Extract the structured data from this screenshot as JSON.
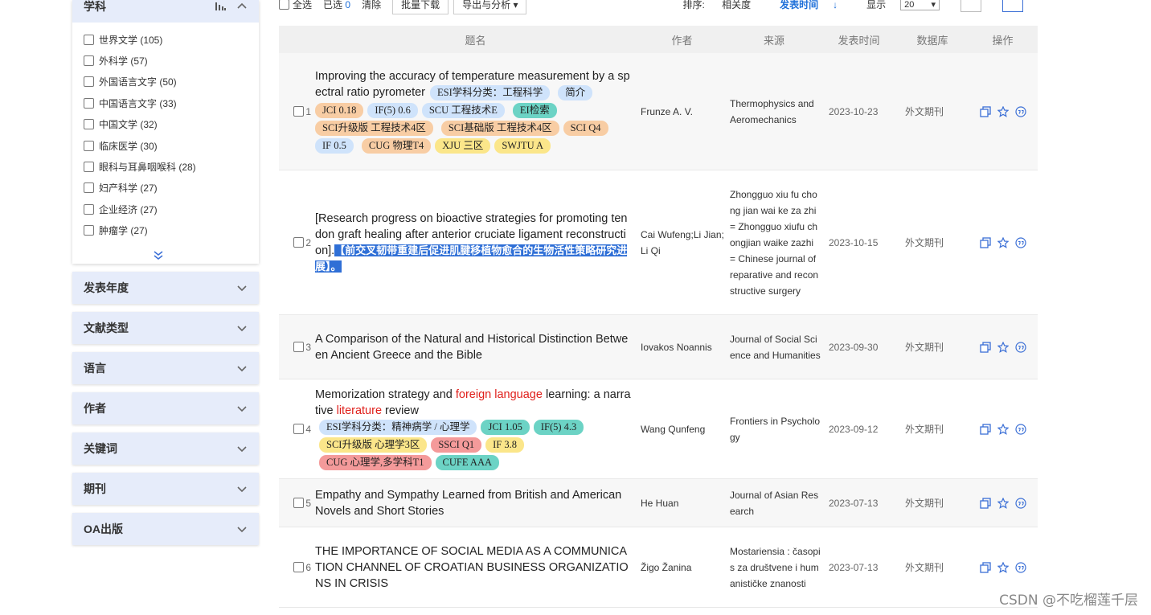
{
  "sidebar": {
    "open_facet": {
      "title": "学科",
      "items": [
        "世界文学 (105)",
        "外科学 (57)",
        "外国语言文字 (50)",
        "中国语言文字 (33)",
        "中国文学 (32)",
        "临床医学 (30)",
        "眼科与耳鼻咽喉科 (28)",
        "妇产科学 (27)",
        "企业经济 (27)",
        "肿瘤学 (27)"
      ]
    },
    "closed_facets": [
      "发表年度",
      "文献类型",
      "语言",
      "作者",
      "关键词",
      "期刊",
      "OA出版"
    ]
  },
  "toolbar": {
    "select_all": "全选",
    "selected_label": "已选",
    "selected_count": "0",
    "clear": "清除",
    "batch_download": "批量下载",
    "export_analysis": "导出与分析",
    "sort_label": "排序:",
    "sort_relevance": "相关度",
    "sort_date": "发表时间",
    "display_label": "显示",
    "page_size": "20"
  },
  "table": {
    "headers": [
      "题名",
      "作者",
      "来源",
      "发表时间",
      "数据库",
      "操作"
    ],
    "rows": [
      {
        "index": "1",
        "title_parts": [
          {
            "text": "Improving the accuracy of temperature measurement by a spectral ratio pyrometer",
            "hl": false
          }
        ],
        "tags": [
          {
            "text": "ESI学科分类：工程科学",
            "color": "blue"
          },
          {
            "text": "简介",
            "color": "blue"
          },
          {
            "text": "JCI 0.18",
            "color": "orange"
          },
          {
            "text": "IF(5) 0.6",
            "color": "blue"
          },
          {
            "text": "SCU 工程技术E",
            "color": "blue"
          },
          {
            "text": "EI检索",
            "color": "teal"
          },
          {
            "text": "SCI升级版 工程技术4区",
            "color": "orange"
          },
          {
            "text": "SCI基础版 工程技术4区",
            "color": "orange"
          },
          {
            "text": "SCI Q4",
            "color": "orange"
          },
          {
            "text": "IF 0.5",
            "color": "blue"
          },
          {
            "text": "CUG 物理T4",
            "color": "orange"
          },
          {
            "text": "XJU 三区",
            "color": "yellow"
          },
          {
            "text": "SWJTU A",
            "color": "yellow"
          }
        ],
        "author": "Frunze A. V.",
        "source": "Thermophysics and Aeromechanics",
        "date": "2023-10-23",
        "db": "外文期刊"
      },
      {
        "index": "2",
        "title_parts": [
          {
            "text": "[Research progress on bioactive strategies for promoting tendon graft healing after anterior cruciate ligament reconstruction].",
            "hl": false
          }
        ],
        "selected_text": "【前交叉韧带重建后促进肌腱移植物愈合的生物活性策略研究进展】。",
        "tags": [],
        "author": "Cai Wufeng;Li Jian;Li Qi",
        "source": "Zhongguo xiu fu chong jian wai ke za zhi = Zhongguo xiufu chongjian waike zazhi = Chinese journal of reparative and reconstructive surgery",
        "date": "2023-10-15",
        "db": "外文期刊"
      },
      {
        "index": "3",
        "title_parts": [
          {
            "text": "A Comparison of the Natural and Historical Distinction Between Ancient Greece and the Bible",
            "hl": false
          }
        ],
        "tags": [],
        "author": "Iovakos Noannis",
        "source": "Journal of Social Science and Humanities",
        "date": "2023-09-30",
        "db": "外文期刊"
      },
      {
        "index": "4",
        "title_parts": [
          {
            "text": "Memorization strategy and ",
            "hl": false
          },
          {
            "text": "foreign language",
            "hl": true
          },
          {
            "text": " learning: a narrative ",
            "hl": false
          },
          {
            "text": "literature",
            "hl": true
          },
          {
            "text": " review",
            "hl": false
          }
        ],
        "tags": [
          {
            "text": "ESI学科分类：精神病学 / 心理学",
            "color": "blue"
          },
          {
            "text": "JCI 1.05",
            "color": "teal"
          },
          {
            "text": "IF(5) 4.3",
            "color": "teal"
          },
          {
            "text": "SCI升级版 心理学3区",
            "color": "yellow"
          },
          {
            "text": "SSCI Q1",
            "color": "red"
          },
          {
            "text": "IF 3.8",
            "color": "yellow"
          },
          {
            "text": "CUG 心理学,多学科T1",
            "color": "red"
          },
          {
            "text": "CUFE AAA",
            "color": "teal"
          }
        ],
        "author": "Wang Qunfeng",
        "source": "Frontiers in Psychology",
        "date": "2023-09-12",
        "db": "外文期刊"
      },
      {
        "index": "5",
        "title_parts": [
          {
            "text": "Empathy and Sympathy Learned from British and American Novels and Short Stories",
            "hl": false
          }
        ],
        "tags": [],
        "author": "He Huan",
        "source": "Journal of Asian Research",
        "date": "2023-07-13",
        "db": "外文期刊"
      },
      {
        "index": "6",
        "title_parts": [
          {
            "text": "THE IMPORTANCE OF SOCIAL MEDIA AS A COMMUNICATION CHANNEL OF CROATIAN BUSINESS ORGANIZATIONS IN CRISIS",
            "hl": false
          }
        ],
        "tags": [],
        "author": "Žigo Žanina",
        "source": "Mostariensia : časopis za društvene i humanističke znanosti",
        "date": "2023-07-13",
        "db": "外文期刊"
      }
    ]
  },
  "colors": {
    "accent": "#2f6fd6",
    "facet_header": "#e6ecfa",
    "highlight_red": "#e0201c",
    "tag_blue": "#cfe3fb",
    "tag_teal": "#6cd3c5",
    "tag_orange": "#f8cda4",
    "tag_yellow": "#fbe68a",
    "tag_red": "#f49a9a"
  },
  "icons": [
    "bar-chart-icon",
    "chevron-up-icon",
    "chevron-down-icon",
    "double-chevron-down-icon",
    "dropdown-caret-icon",
    "sort-arrow-down-icon",
    "grid-view-icon",
    "list-view-icon",
    "copy-icon",
    "star-icon",
    "quote-icon"
  ],
  "watermark": "CSDN @不吃榴莲千层"
}
